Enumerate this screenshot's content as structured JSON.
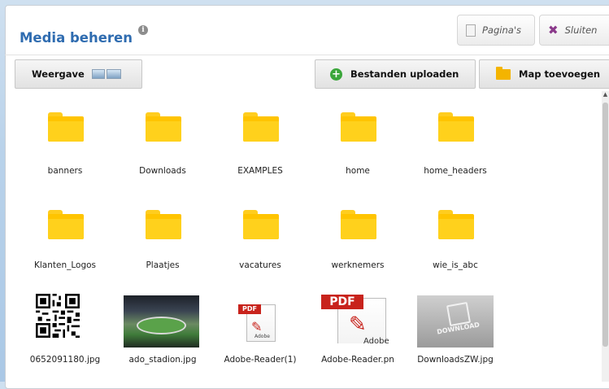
{
  "header": {
    "title": "Media beheren",
    "info_icon": "info-icon",
    "paginas_label": "Pagina's",
    "sluiten_label": "Sluiten"
  },
  "toolbar": {
    "weergave_label": "Weergave",
    "upload_label": "Bestanden uploaden",
    "add_folder_label": "Map toevoegen"
  },
  "folders": [
    {
      "name": "banners"
    },
    {
      "name": "Downloads"
    },
    {
      "name": "EXAMPLES"
    },
    {
      "name": "home"
    },
    {
      "name": "home_headers"
    },
    {
      "name": "Klanten_Logos"
    },
    {
      "name": "Plaatjes"
    },
    {
      "name": "vacatures"
    },
    {
      "name": "werknemers"
    },
    {
      "name": "wie_is_abc"
    }
  ],
  "files": [
    {
      "name": "0652091180.jpg"
    },
    {
      "name": "ado_stadion.jpg"
    },
    {
      "name": "Adobe-Reader(1)"
    },
    {
      "name": "Adobe-Reader.pn"
    },
    {
      "name": "DownloadsZW.jpg"
    }
  ],
  "file_thumbs": {
    "pdf_tag": "PDF",
    "adobe_text": "Adobe",
    "download_text": "DOWNLOAD"
  },
  "colors": {
    "title": "#2f6cb0",
    "folder": "#ffc400",
    "upload_icon": "#3aa63a",
    "close_icon": "#8b3a8b"
  }
}
